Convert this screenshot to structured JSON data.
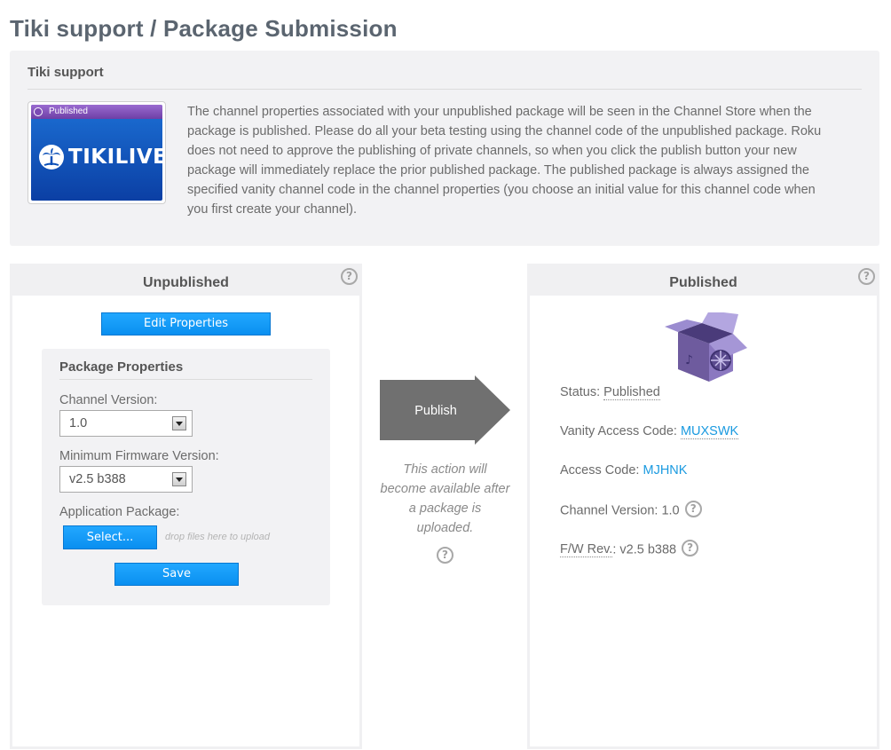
{
  "page_title": "Tiki support / Package Submission",
  "info": {
    "heading": "Tiki support",
    "thumbnail_badge": "Published",
    "thumbnail_logo_text": "TIKILIVE",
    "description": "The channel properties associated with your unpublished package will be seen in the Channel Store when the package is published. Please do all your beta testing using the channel code of the unpublished package. Roku does not need to approve the publishing of private channels, so when you click the publish button your new package will immediately replace the prior published package. The published package is always assigned the specified vanity channel code in the channel properties (you choose an initial value for this channel code when you first create your channel)."
  },
  "unpublished": {
    "title": "Unpublished",
    "edit_button": "Edit Properties",
    "package_properties": {
      "title": "Package Properties",
      "channel_version_label": "Channel Version:",
      "channel_version_value": "1.0",
      "min_firmware_label": "Minimum Firmware Version:",
      "min_firmware_value": "v2.5 b388",
      "app_package_label": "Application Package:",
      "select_button": "Select...",
      "drop_hint": "drop files here to upload",
      "save_button": "Save"
    }
  },
  "middle": {
    "publish_button": "Publish",
    "note": "This action will become available after a package is uploaded."
  },
  "published": {
    "title": "Published",
    "status_label": "Status:",
    "status_value": "Published",
    "vanity_label": "Vanity Access Code:",
    "vanity_value": "MUXSWK",
    "access_label": "Access Code:",
    "access_value": "MJHNK",
    "channel_version_label": "Channel Version:",
    "channel_version_value": "1.0",
    "fw_label": "F/W Rev.",
    "fw_value": ": v2.5 b388"
  },
  "help_glyph": "?",
  "colors": {
    "accent_blue": "#1a9ae0",
    "button_blue": "#0a8ff0",
    "publish_gray": "#707070",
    "panel_gray": "#f2f2f4"
  }
}
